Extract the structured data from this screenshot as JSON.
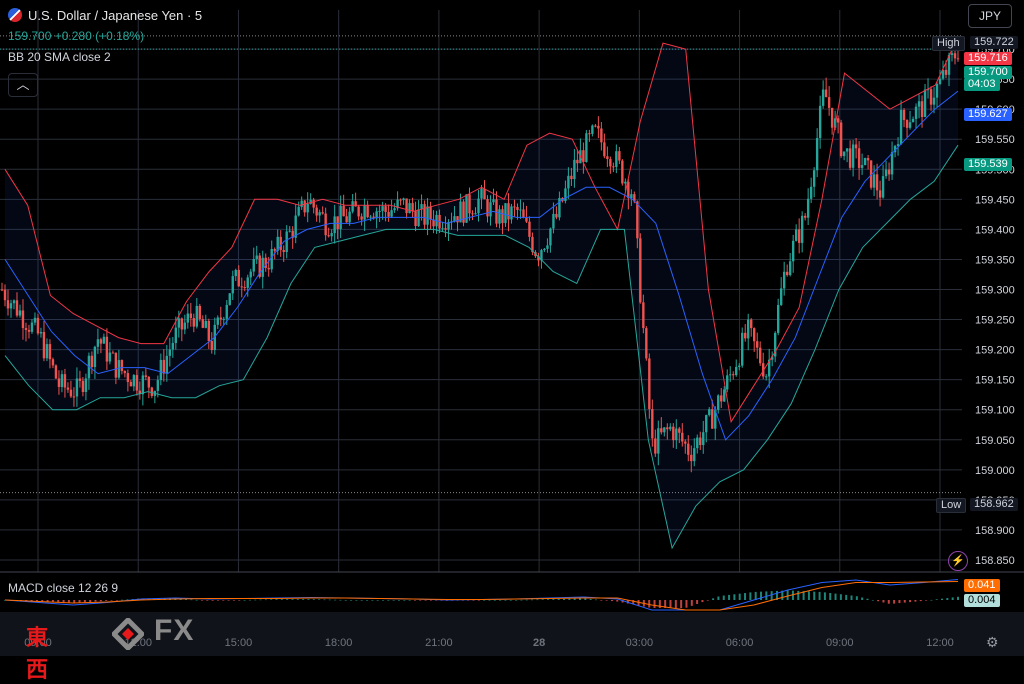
{
  "header": {
    "title": "U.S. Dollar / Japanese Yen · 5",
    "price_change": "159.700 +0.280 (+0.18%)",
    "indicator": "BB 20 SMA close 2",
    "macd_label": "MACD close 12 26 9",
    "collapse_icon": "chevron-up-icon"
  },
  "currency": "JPY",
  "tags": {
    "high_label": "High",
    "high_value": "159.722",
    "upper_band": "159.716",
    "last_price": "159.700",
    "countdown": "04:03",
    "basis": "159.627",
    "lower_band": "159.539",
    "low_label": "Low",
    "low_value": "158.962",
    "macd_value": "0.041",
    "macd_hist": "0.004"
  },
  "logo": {
    "text_kanji": "東西",
    "text_fx": "FX"
  },
  "colors": {
    "up": "#26a69a",
    "down": "#ef5350",
    "upper": "#f23645",
    "basis": "#2962ff",
    "lower": "#26a69a",
    "macd": "#2962ff",
    "signal": "#ff6d00",
    "grid": "#2a2e39",
    "text": "#d1d4dc"
  },
  "chart_data": {
    "type": "candlestick",
    "x_labels": [
      "09:00",
      "12:00",
      "15:00",
      "18:00",
      "21:00",
      "28",
      "03:00",
      "06:00",
      "09:00",
      "12:00"
    ],
    "y_ticks": [
      "159.700",
      "159.650",
      "159.600",
      "159.550",
      "159.500",
      "159.450",
      "159.400",
      "159.350",
      "159.300",
      "159.250",
      "159.200",
      "159.150",
      "159.100",
      "159.050",
      "159.000",
      "158.950",
      "158.900",
      "158.850"
    ],
    "ylim": [
      158.83,
      159.765
    ],
    "price_series": [
      159.3,
      159.26,
      159.22,
      159.14,
      159.13,
      159.22,
      159.17,
      159.15,
      159.14,
      159.22,
      159.26,
      159.21,
      159.31,
      159.33,
      159.35,
      159.39,
      159.45,
      159.41,
      159.42,
      159.44,
      159.43,
      159.44,
      159.42,
      159.42,
      159.43,
      159.45,
      159.42,
      159.43,
      159.36,
      159.42,
      159.51,
      159.56,
      159.52,
      159.46,
      159.04,
      159.07,
      159.03,
      159.08,
      159.15,
      159.23,
      159.16,
      159.34,
      159.42,
      159.63,
      159.53,
      159.51,
      159.46,
      159.58,
      159.6,
      159.64,
      159.7
    ],
    "series": [
      {
        "name": "Upper",
        "values": [
          159.5,
          159.44,
          159.29,
          159.26,
          159.24,
          159.22,
          159.21,
          159.21,
          159.28,
          159.33,
          159.37,
          159.45,
          159.45,
          159.44,
          159.45,
          159.44,
          159.44,
          159.44,
          159.43,
          159.44,
          159.45,
          159.47,
          159.45,
          159.54,
          159.56,
          159.55,
          159.47,
          159.4,
          159.58,
          159.71,
          159.7,
          159.3,
          159.08,
          159.14,
          159.2,
          159.27,
          159.45,
          159.66,
          159.63,
          159.6,
          159.62,
          159.64,
          159.72
        ]
      },
      {
        "name": "Basis",
        "values": [
          159.35,
          159.29,
          159.23,
          159.19,
          159.16,
          159.17,
          159.17,
          159.16,
          159.19,
          159.22,
          159.27,
          159.33,
          159.38,
          159.4,
          159.41,
          159.41,
          159.42,
          159.42,
          159.42,
          159.41,
          159.42,
          159.43,
          159.42,
          159.42,
          159.45,
          159.47,
          159.47,
          159.45,
          159.41,
          159.29,
          159.16,
          159.05,
          159.09,
          159.15,
          159.22,
          159.32,
          159.42,
          159.48,
          159.52,
          159.56,
          159.6,
          159.63
        ]
      },
      {
        "name": "Lower",
        "values": [
          159.19,
          159.14,
          159.1,
          159.1,
          159.12,
          159.12,
          159.13,
          159.12,
          159.12,
          159.14,
          159.15,
          159.22,
          159.31,
          159.37,
          159.38,
          159.39,
          159.4,
          159.4,
          159.4,
          159.39,
          159.39,
          159.39,
          159.37,
          159.33,
          159.31,
          159.4,
          159.4,
          159.05,
          158.87,
          158.94,
          158.98,
          159.0,
          159.05,
          159.11,
          159.2,
          159.3,
          159.37,
          159.41,
          159.45,
          159.48,
          159.54
        ]
      },
      {
        "name": "MACD",
        "values": [
          0.0,
          -0.005,
          -0.01,
          -0.005,
          0.002,
          0.004,
          0.002,
          0.003,
          0.004,
          0.005,
          0.004,
          0.003,
          0.002,
          0.0,
          0.001,
          0.002,
          0.004,
          0.006,
          0.002,
          -0.02,
          -0.035,
          -0.02,
          0.0,
          0.02,
          0.035,
          0.04,
          0.03,
          0.035,
          0.041
        ]
      },
      {
        "name": "Signal",
        "values": [
          0.0,
          -0.003,
          -0.006,
          -0.004,
          0.0,
          0.002,
          0.003,
          0.003,
          0.003,
          0.004,
          0.004,
          0.003,
          0.002,
          0.001,
          0.001,
          0.002,
          0.003,
          0.004,
          0.004,
          -0.01,
          -0.025,
          -0.025,
          -0.01,
          0.008,
          0.025,
          0.035,
          0.035,
          0.036,
          0.037
        ]
      }
    ]
  }
}
